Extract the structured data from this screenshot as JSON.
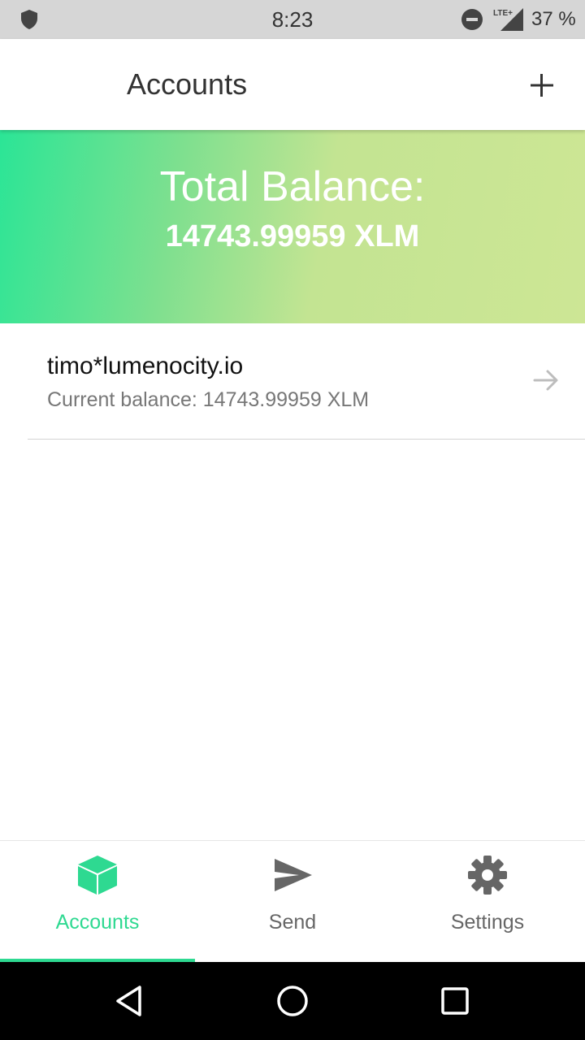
{
  "status_bar": {
    "time": "8:23",
    "network_label": "LTE+",
    "battery": "37 %",
    "icons": [
      "shield-icon",
      "do-not-disturb-icon",
      "signal-icon"
    ]
  },
  "app_bar": {
    "title": "Accounts",
    "add_icon": "plus-icon"
  },
  "banner": {
    "label": "Total Balance:",
    "amount": "14743.99959 XLM"
  },
  "accounts": [
    {
      "name": "timo*lumenocity.io",
      "balance": "Current balance: 14743.99959 XLM",
      "icon": "arrow-right-icon"
    }
  ],
  "bottom_nav": {
    "tabs": [
      {
        "label": "Accounts",
        "icon": "cube-icon",
        "active": true
      },
      {
        "label": "Send",
        "icon": "send-icon",
        "active": false
      },
      {
        "label": "Settings",
        "icon": "gear-icon",
        "active": false
      }
    ]
  },
  "system_nav": {
    "buttons": [
      "back-icon",
      "home-icon",
      "recents-icon"
    ]
  },
  "colors": {
    "accent": "#2ed991",
    "status_bar": "#d6d6d6",
    "banner_start": "#2be596",
    "banner_end": "#cde695"
  }
}
